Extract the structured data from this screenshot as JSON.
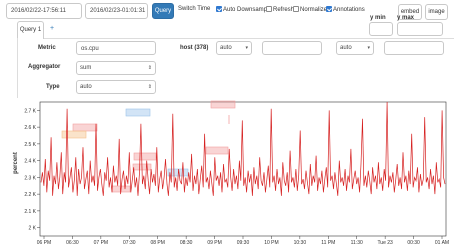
{
  "toolbar": {
    "start_time": "2016/02/22-17:56:11",
    "end_time": "2016/02/23-01:01:31",
    "query_label": "Query",
    "switch_time_label": "Switch Time",
    "auto_downsample_label": "Auto Downsample",
    "refresh_label": "Refresh",
    "normalize_label": "Normalize",
    "annotations_label": "Annotations",
    "embed_label": "embed",
    "image_label": "image"
  },
  "checkboxes": {
    "auto_downsample": true,
    "refresh": false,
    "normalize": false,
    "annotations": true
  },
  "tabs": {
    "query_tab": "Query 1",
    "add_tab": "+"
  },
  "axis_inputs": {
    "ymin_label": "y min",
    "ymax_label": "y max",
    "ymin_value": "",
    "ymax_value": ""
  },
  "form": {
    "metric_label": "Metric",
    "metric_value": "os.cpu",
    "aggregator_label": "Aggregator",
    "aggregator_value": "sum",
    "type_label": "Type",
    "type_value": "auto",
    "tag_key": "host (378)",
    "tag_select_value": "auto",
    "tag_value": "",
    "tag_select2_value": "auto"
  },
  "colors": {
    "series": "#d62020",
    "annotation_red": "#f2a0a0",
    "annotation_blue": "#9cc3ea",
    "annotation_orange": "#f5c08a",
    "primary": "#337ab7"
  },
  "chart_data": {
    "type": "line",
    "ylabel": "percent",
    "y_ticks": [
      "2 K",
      "2.1 K",
      "2.2 K",
      "2.3 K",
      "2.4 K",
      "2.5 K",
      "2.6 K",
      "2.7 K"
    ],
    "x_ticks": [
      "06 PM",
      "06:30",
      "07 PM",
      "07:30",
      "08 PM",
      "08:30",
      "09 PM",
      "09:30",
      "10 PM",
      "10:30",
      "11 PM",
      "11:30",
      "Tue 23",
      "00:30",
      "01 AM"
    ],
    "ylim": [
      1950,
      2750
    ],
    "series": [
      {
        "values": [
          2270,
          2330,
          2250,
          2410,
          2210,
          2340,
          2280,
          2540,
          2190,
          2310,
          2260,
          2390,
          2230,
          2300,
          2450,
          2200,
          2330,
          2270,
          2710,
          2240,
          2300,
          2360,
          2210,
          2280,
          2420,
          2190,
          2350,
          2260,
          2300,
          2480,
          2230,
          2290,
          2340,
          2200,
          2400,
          2270,
          2310,
          2250,
          2620,
          2220,
          2300,
          2350,
          2260,
          2190,
          2330,
          2280,
          2420,
          2240,
          2300,
          2210,
          2370,
          2270,
          2310,
          2250,
          2530,
          2200,
          2290,
          2340,
          2230,
          2310,
          2260,
          2450,
          2210,
          2280,
          2360,
          2240,
          2300,
          2190,
          2330,
          2620,
          2260,
          2310,
          2230,
          2400,
          2280,
          2200,
          2350,
          2270,
          2320,
          2250,
          2480,
          2210,
          2290,
          2340,
          2230,
          2300,
          2410,
          2260,
          2190,
          2330,
          2270,
          2680,
          2240,
          2300,
          2220,
          2350,
          2280,
          2260,
          2390,
          2210,
          2300,
          2250,
          2330,
          2270,
          2440,
          2220,
          2310,
          2260,
          2350,
          2200,
          2290,
          2370,
          2240,
          2560,
          2270,
          2300,
          2230,
          2340,
          2260,
          2190,
          2420,
          2280,
          2310,
          2250,
          2330,
          2210,
          2380,
          2270,
          2290,
          2240,
          2470,
          2300,
          2220,
          2350,
          2260,
          2310,
          2230,
          2400,
          2280,
          2640,
          2250,
          2300,
          2210,
          2340,
          2270,
          2320,
          2190,
          2360,
          2260,
          2310,
          2230,
          2420,
          2280,
          2250,
          2330,
          2210,
          2290,
          2370,
          2240,
          2710,
          2270,
          2310,
          2220,
          2350,
          2260,
          2300,
          2190,
          2390,
          2280,
          2250,
          2330,
          2210,
          2460,
          2270,
          2300,
          2240,
          2350,
          2220,
          2310,
          2580,
          2260,
          2290,
          2230,
          2340,
          2270,
          2200,
          2380,
          2250,
          2310,
          2270,
          2430,
          2220,
          2300,
          2260,
          2340,
          2210,
          2290,
          2360,
          2240,
          2700,
          2280,
          2310,
          2230,
          2330,
          2260,
          2190,
          2400,
          2270,
          2300,
          2250,
          2350,
          2220,
          2310,
          2270,
          2470,
          2230,
          2290,
          2340,
          2260,
          2300,
          2210,
          2380,
          2650,
          2250,
          2310,
          2240,
          2340,
          2280,
          2200,
          2360,
          2270,
          2310,
          2230,
          2390,
          2260,
          2300,
          2220,
          2350,
          2280,
          2750,
          2240,
          2310,
          2270,
          2330,
          2210,
          2290,
          2380,
          2250,
          2300,
          2230,
          2450,
          2270,
          2310,
          2220,
          2340,
          2260,
          2560,
          2240,
          2300,
          2280,
          2360,
          2210,
          2320,
          2250,
          2290,
          2660,
          2270,
          2300,
          2230,
          2350,
          2260,
          2310,
          2200,
          2390,
          2270,
          2290,
          2240,
          2700,
          2300,
          2260
        ]
      }
    ]
  },
  "annotations": [
    "",
    "",
    "",
    "",
    "",
    "",
    "",
    "",
    ""
  ]
}
